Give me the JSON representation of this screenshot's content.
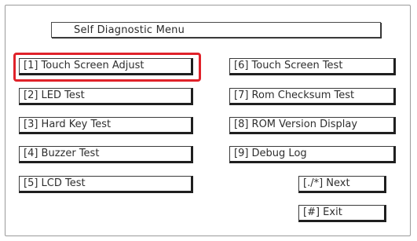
{
  "window": {
    "title": "Self Diagnostic Menu"
  },
  "menu": {
    "left": [
      {
        "label": "[1] Touch Screen Adjust",
        "selected": true
      },
      {
        "label": "[2] LED Test"
      },
      {
        "label": "[3] Hard Key Test"
      },
      {
        "label": "[4] Buzzer Test"
      },
      {
        "label": "[5] LCD Test"
      }
    ],
    "right": [
      {
        "label": "[6] Touch Screen Test"
      },
      {
        "label": "[7] Rom Checksum Test"
      },
      {
        "label": "[8] ROM Version Display"
      },
      {
        "label": "[9] Debug Log"
      }
    ],
    "next_label": "[./*] Next",
    "exit_label": "[#] Exit"
  },
  "colors": {
    "selection": "#e0222a",
    "border": "#3a3a3a",
    "text": "#2e2e2e"
  }
}
